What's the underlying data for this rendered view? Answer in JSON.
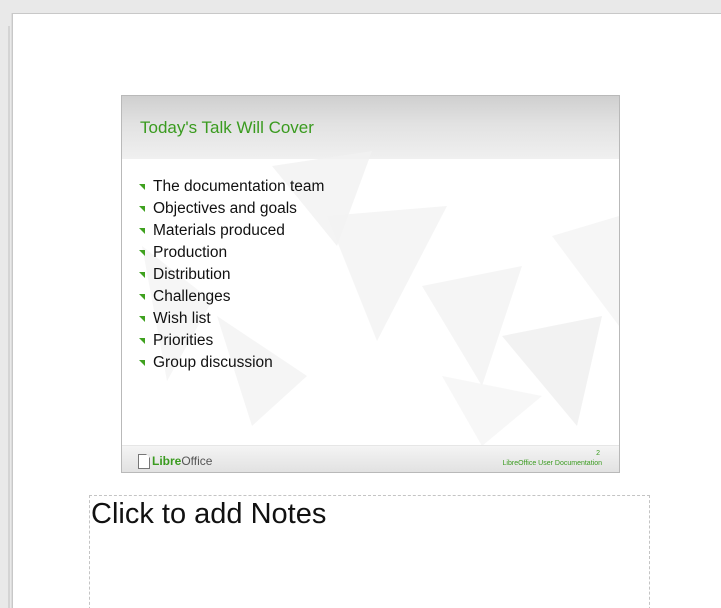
{
  "slide": {
    "title": "Today's Talk Will Cover",
    "bullets": [
      "The documentation team",
      "Objectives and goals",
      "Materials produced",
      "Production",
      "Distribution",
      "Challenges",
      "Wish list",
      "Priorities",
      "Group discussion"
    ],
    "footer": {
      "logo_libre": "Libre",
      "logo_office": "Office",
      "doc_title": "LibreOffice User Documentation",
      "page_number": "2"
    }
  },
  "notes": {
    "placeholder": "Click to add Notes"
  },
  "colors": {
    "accent_green": "#3a9b1f",
    "workspace_bg": "#e9e9e9"
  },
  "icons": {
    "bullet": "green-triangle-bullet-icon",
    "logo": "libreoffice-document-icon"
  }
}
